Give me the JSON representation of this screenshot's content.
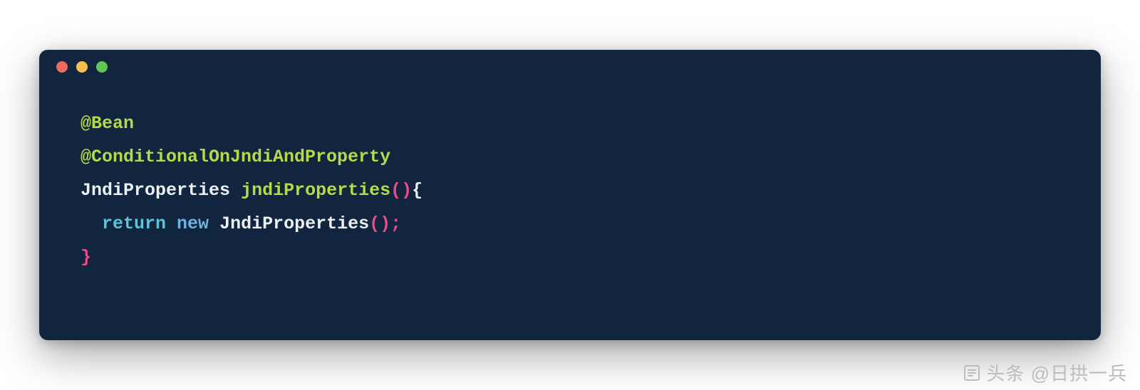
{
  "code": {
    "line1": {
      "annotation": "@Bean"
    },
    "line2": {
      "annotation": "@ConditionalOnJndiAndProperty"
    },
    "line3": {
      "type": "JndiProperties",
      "space": " ",
      "method": "jndiProperties",
      "parens": "()",
      "brace_open": "{"
    },
    "line4": {
      "indent": "  ",
      "return_kw": "return",
      "space1": " ",
      "new_kw": "new",
      "space2": " ",
      "type": "JndiProperties",
      "parens": "()",
      "semi": ";"
    },
    "line5": {
      "brace_close": "}"
    }
  },
  "watermark": {
    "text": "头条 @日拱一兵"
  }
}
